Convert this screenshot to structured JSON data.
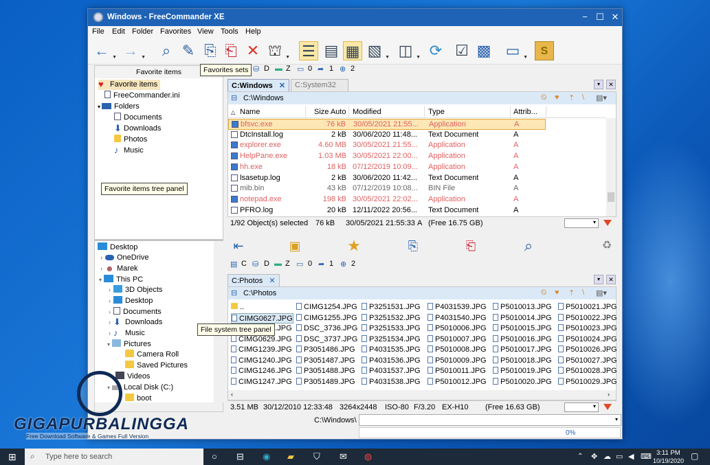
{
  "window": {
    "title": "Windows - FreeCommander XE",
    "min": "−",
    "max": "☐",
    "close": "✕"
  },
  "menu": [
    "File",
    "Edit",
    "Folder",
    "Favorites",
    "View",
    "Tools",
    "Help"
  ],
  "favorites_panel": {
    "header": "Favorite items",
    "items": [
      {
        "label": "Favorite items",
        "icon": "heart-icon"
      },
      {
        "label": "FreeCommander.ini",
        "icon": "file-icon"
      },
      {
        "label": "Folders",
        "icon": "folder-icon"
      },
      {
        "label": "Documents",
        "icon": "documents-icon"
      },
      {
        "label": "Downloads",
        "icon": "download-icon"
      },
      {
        "label": "Photos",
        "icon": "folder-icon"
      },
      {
        "label": "Music",
        "icon": "music-icon"
      }
    ]
  },
  "callouts": {
    "favorites_sets": "Favorites sets",
    "favorites_tree": "Favorite items tree panel",
    "fs_tree": "File system tree panel"
  },
  "fs_tree": [
    {
      "label": "Desktop",
      "indent": 0
    },
    {
      "label": "OneDrive",
      "indent": 1
    },
    {
      "label": "Marek",
      "indent": 1
    },
    {
      "label": "This PC",
      "indent": 1
    },
    {
      "label": "3D Objects",
      "indent": 2
    },
    {
      "label": "Desktop",
      "indent": 2
    },
    {
      "label": "Documents",
      "indent": 2
    },
    {
      "label": "Downloads",
      "indent": 2
    },
    {
      "label": "Music",
      "indent": 2
    },
    {
      "label": "Pictures",
      "indent": 2
    },
    {
      "label": "Camera Roll",
      "indent": 3
    },
    {
      "label": "Saved Pictures",
      "indent": 3
    },
    {
      "label": "Videos",
      "indent": 2
    },
    {
      "label": "Local Disk (C:)",
      "indent": 2
    },
    {
      "label": "boot",
      "indent": 3
    }
  ],
  "drives": {
    "c": "C",
    "d": "D",
    "z": "Z",
    "n0": "0",
    "n1": "1",
    "n2": "2"
  },
  "top": {
    "tab_active": "C:Windows",
    "tab_other": "C:System32",
    "path": "C:\\Windows",
    "columns": [
      "Name",
      "Size Auto",
      "Modified",
      "Type",
      "Attrib..."
    ],
    "rows": [
      {
        "name": "bfsvc.exe",
        "size": "76 kB",
        "modified": "30/05/2021 21:55...",
        "type": "Application",
        "attr": "A",
        "app": true,
        "sel": true
      },
      {
        "name": "DtcInstall.log",
        "size": "2 kB",
        "modified": "30/06/2020 11:48...",
        "type": "Text Document",
        "attr": "A",
        "app": false
      },
      {
        "name": "explorer.exe",
        "size": "4.60 MB",
        "modified": "30/05/2021 21:55...",
        "type": "Application",
        "attr": "A",
        "app": true
      },
      {
        "name": "HelpPane.exe",
        "size": "1.03 MB",
        "modified": "30/05/2021 22:00...",
        "type": "Application",
        "attr": "A",
        "app": true
      },
      {
        "name": "hh.exe",
        "size": "18 kB",
        "modified": "07/12/2019 10:09...",
        "type": "Application",
        "attr": "A",
        "app": true
      },
      {
        "name": "lsasetup.log",
        "size": "2 kB",
        "modified": "30/06/2020 11:42...",
        "type": "Text Document",
        "attr": "A",
        "app": false
      },
      {
        "name": "mib.bin",
        "size": "43 kB",
        "modified": "07/12/2019 10:08...",
        "type": "BIN File",
        "attr": "A",
        "app": false,
        "bin": true
      },
      {
        "name": "notepad.exe",
        "size": "198 kB",
        "modified": "30/05/2021 22:02...",
        "type": "Application",
        "attr": "A",
        "app": true
      },
      {
        "name": "PFRO.log",
        "size": "20 kB",
        "modified": "12/11/2022 20:56...",
        "type": "Text Document",
        "attr": "A",
        "app": false
      }
    ],
    "status": {
      "count": "1/92 Object(s) selected",
      "size": "76 kB",
      "date": "30/05/2021 21:55:33",
      "attr": "A",
      "free": "(Free 16.75 GB)"
    }
  },
  "bottom": {
    "tab": "C:Photos",
    "path": "C:\\Photos",
    "columns": [
      [
        "..",
        "CIMG0627.JPG",
        "CIMG0628.JPG",
        "CIMG0629.JPG",
        "CIMG1239.JPG",
        "CIMG1240.JPG",
        "CIMG1246.JPG",
        "CIMG1247.JPG"
      ],
      [
        "CIMG1254.JPG",
        "CIMG1255.JPG",
        "DSC_3736.JPG",
        "DSC_3737.JPG",
        "P3051486.JPG",
        "P3051487.JPG",
        "P3051488.JPG",
        "P3051489.JPG"
      ],
      [
        "P3251531.JPG",
        "P3251532.JPG",
        "P3251533.JPG",
        "P3251534.JPG",
        "P4031535.JPG",
        "P4031536.JPG",
        "P4031537.JPG",
        "P4031538.JPG"
      ],
      [
        "P4031539.JPG",
        "P4031540.JPG",
        "P5010006.JPG",
        "P5010007.JPG",
        "P5010008.JPG",
        "P5010009.JPG",
        "P5010011.JPG",
        "P5010012.JPG"
      ],
      [
        "P5010013.JPG",
        "P5010014.JPG",
        "P5010015.JPG",
        "P5010016.JPG",
        "P5010017.JPG",
        "P5010018.JPG",
        "P5010019.JPG",
        "P5010020.JPG"
      ],
      [
        "P5010021.JPG",
        "P5010022.JPG",
        "P5010023.JPG",
        "P5010024.JPG",
        "P5010026.JPG",
        "P5010027.JPG",
        "P5010028.JPG",
        "P5010029.JPG"
      ]
    ],
    "status": {
      "size": "3.51 MB",
      "date": "30/12/2010 12:33:48",
      "dims": "3264x2448",
      "iso": "ISO-80",
      "f": "F/3.20",
      "model": "EX-H10",
      "free": "(Free 16.63 GB)"
    }
  },
  "command": {
    "path": "C:\\Windows\\",
    "progress": "0%"
  },
  "watermark": {
    "title": "GIGAPURBALINGGA",
    "sub": "Free Download Software & Games Full Version"
  },
  "taskbar": {
    "search": "Type here to search",
    "time": "3:11 PM",
    "date": "10/19/2020"
  },
  "colors": {
    "accent": "#1e63b5",
    "selection": "#fce7b5",
    "application": "#e06060"
  }
}
